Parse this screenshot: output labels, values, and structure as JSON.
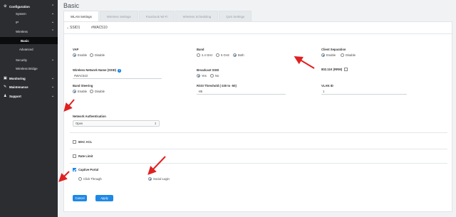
{
  "sidebar": {
    "items": [
      {
        "label": "Configuration",
        "icon": "gear-icon"
      },
      {
        "label": "System"
      },
      {
        "label": "IP"
      },
      {
        "label": "Wireless"
      },
      {
        "label": "Basic"
      },
      {
        "label": "Advanced"
      },
      {
        "label": "Security"
      },
      {
        "label": "Wireless Bridge"
      },
      {
        "label": "Monitoring",
        "icon": "monitor-icon"
      },
      {
        "label": "Maintenance",
        "icon": "wrench-icon"
      },
      {
        "label": "Support",
        "icon": "people-icon"
      }
    ]
  },
  "page": {
    "title": "Basic"
  },
  "tabs": [
    "WLAN Settings",
    "Wireless Settings",
    "Facebook Wi-Fi",
    "Wireless Scheduling",
    "QoS Settings"
  ],
  "ssid": {
    "label": "SSID1",
    "name": "#WAC510"
  },
  "fields": {
    "vap": {
      "label": "VAP",
      "options": [
        "Enable",
        "Disable"
      ],
      "selected": "Enable"
    },
    "band": {
      "label": "Band",
      "options": [
        "2.4 GHz",
        "5 GHz",
        "Both"
      ],
      "selected": "Both"
    },
    "client_separation": {
      "label": "Client Separation",
      "options": [
        "Enable",
        "Disable"
      ],
      "selected": "Enable"
    },
    "ssid_name": {
      "label": "Wireless Network Name (SSID)",
      "value": "#WAC510"
    },
    "broadcast_ssid": {
      "label": "Broadcast SSID",
      "options": [
        "Yes",
        "No"
      ],
      "selected": "Yes"
    },
    "dot11k": {
      "label": "802.11K (RRM)",
      "checked": false
    },
    "band_steering": {
      "label": "Band Steering",
      "options": [
        "Enable",
        "Disable"
      ],
      "selected": "Enable"
    },
    "rssi": {
      "label": "RSSI Threshold (-100 to -50)",
      "value": "-85"
    },
    "vlan": {
      "label": "VLAN ID",
      "value": "1"
    },
    "network_auth": {
      "label": "Network Authentication",
      "value": "Open"
    },
    "mac_acl": {
      "label": "MAC ACL",
      "checked": false
    },
    "rate_limit": {
      "label": "Rate Limit",
      "checked": false
    },
    "captive_portal": {
      "label": "Captive Portal",
      "checked": true,
      "options": [
        "Click Through",
        "Social Login"
      ],
      "selected": "Social Login"
    }
  },
  "buttons": {
    "cancel": "Cancel",
    "apply": "Apply"
  },
  "colors": {
    "accent": "#1e88e5",
    "sidebar": "#2b2d31",
    "arrow": "#e02020"
  }
}
